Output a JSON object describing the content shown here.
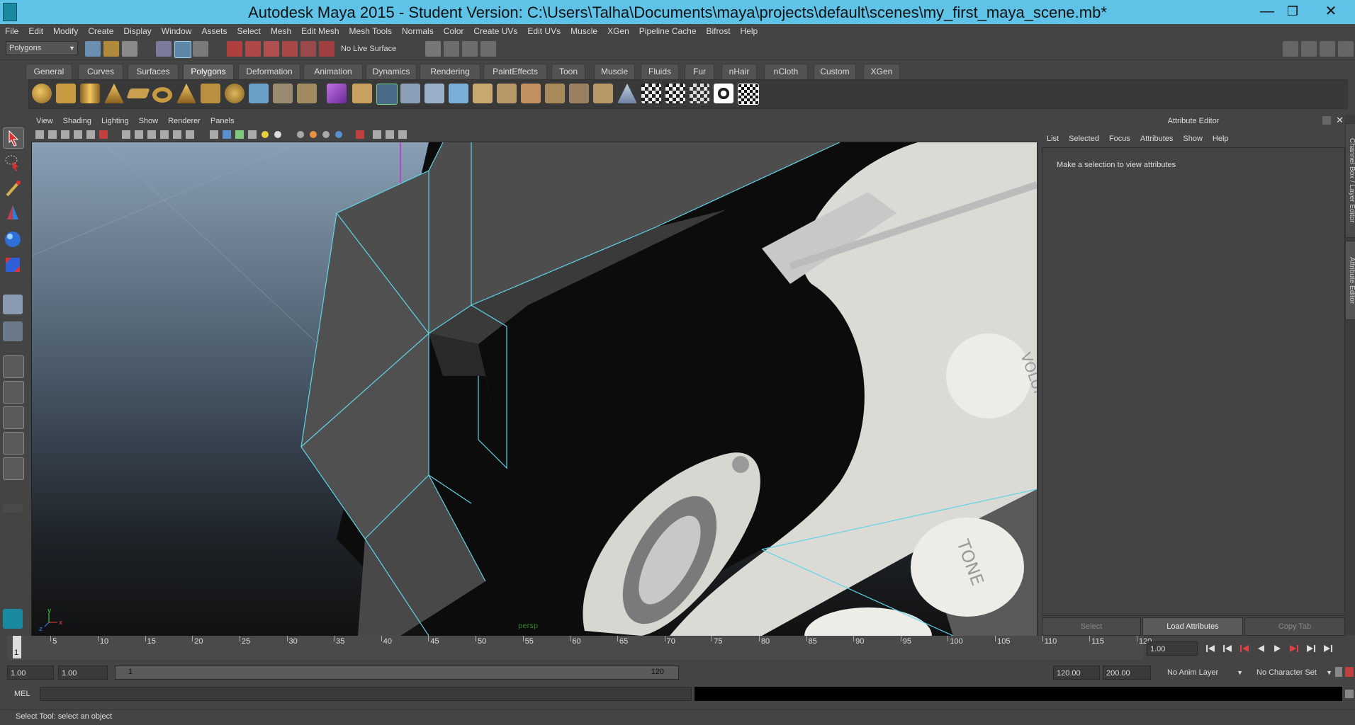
{
  "window": {
    "title": "Autodesk Maya 2015 - Student Version: C:\\Users\\Talha\\Documents\\maya\\projects\\default\\scenes\\my_first_maya_scene.mb*",
    "minimize": "—",
    "maximize": "❐",
    "close": "✕"
  },
  "menubar": [
    "File",
    "Edit",
    "Modify",
    "Create",
    "Display",
    "Window",
    "Assets",
    "Select",
    "Mesh",
    "Edit Mesh",
    "Mesh Tools",
    "Normals",
    "Color",
    "Create UVs",
    "Edit UVs",
    "Muscle",
    "XGen",
    "Pipeline Cache",
    "Bifrost",
    "Help"
  ],
  "statusline": {
    "menuset": "Polygons",
    "live_surface": "No Live Surface"
  },
  "shelf": {
    "tabs": [
      "General",
      "Curves",
      "Surfaces",
      "Polygons",
      "Deformation",
      "Animation",
      "Dynamics",
      "Rendering",
      "PaintEffects",
      "Toon",
      "Muscle",
      "Fluids",
      "Fur",
      "nHair",
      "nCloth",
      "Custom",
      "XGen"
    ],
    "active_tab": "Polygons"
  },
  "viewport": {
    "menu": [
      "View",
      "Shading",
      "Lighting",
      "Show",
      "Renderer",
      "Panels"
    ],
    "camera_label": "persp",
    "knob_volume": "VOLUME",
    "knob_tone": "TONE",
    "axis_x": "x",
    "axis_y": "y",
    "axis_z": "z"
  },
  "attribute_editor": {
    "title": "Attribute Editor",
    "menu": [
      "List",
      "Selected",
      "Focus",
      "Attributes",
      "Show",
      "Help"
    ],
    "message": "Make a selection to view attributes",
    "buttons": {
      "select": "Select",
      "load": "Load Attributes",
      "copy": "Copy Tab"
    }
  },
  "side_tabs": {
    "channel_box": "Channel Box / Layer Editor",
    "attribute_editor": "Attribute Editor"
  },
  "timeslider": {
    "ticks": [
      "5",
      "10",
      "15",
      "20",
      "25",
      "30",
      "35",
      "40",
      "45",
      "50",
      "55",
      "60",
      "65",
      "70",
      "75",
      "80",
      "85",
      "90",
      "95",
      "100",
      "105",
      "110",
      "115",
      "120"
    ],
    "current_frame": "1",
    "current_time": "1.00"
  },
  "range": {
    "start_time": "1.00",
    "start_range": "1.00",
    "slider_start": "1",
    "slider_end": "120",
    "end_range": "120.00",
    "end_time": "200.00",
    "anim_layer": "No Anim Layer",
    "character_set": "No Character Set"
  },
  "command": {
    "mode": "MEL"
  },
  "help_line": "Select Tool: select an object",
  "colors": {
    "title_bar": "#5ec3e6",
    "panel": "#444444",
    "accent": "#5285a6",
    "wireframe": "#5fd4e8"
  }
}
